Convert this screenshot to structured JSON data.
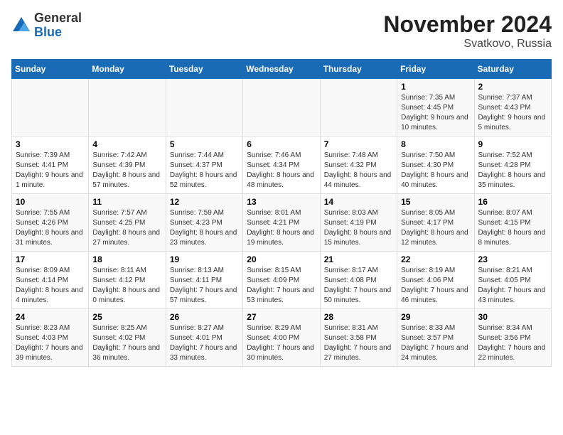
{
  "header": {
    "logo_general": "General",
    "logo_blue": "Blue",
    "month_title": "November 2024",
    "location": "Svatkovo, Russia"
  },
  "weekdays": [
    "Sunday",
    "Monday",
    "Tuesday",
    "Wednesday",
    "Thursday",
    "Friday",
    "Saturday"
  ],
  "weeks": [
    [
      null,
      null,
      null,
      null,
      null,
      {
        "day": "1",
        "sunrise": "Sunrise: 7:35 AM",
        "sunset": "Sunset: 4:45 PM",
        "daylight": "Daylight: 9 hours and 10 minutes."
      },
      {
        "day": "2",
        "sunrise": "Sunrise: 7:37 AM",
        "sunset": "Sunset: 4:43 PM",
        "daylight": "Daylight: 9 hours and 5 minutes."
      }
    ],
    [
      {
        "day": "3",
        "sunrise": "Sunrise: 7:39 AM",
        "sunset": "Sunset: 4:41 PM",
        "daylight": "Daylight: 9 hours and 1 minute."
      },
      {
        "day": "4",
        "sunrise": "Sunrise: 7:42 AM",
        "sunset": "Sunset: 4:39 PM",
        "daylight": "Daylight: 8 hours and 57 minutes."
      },
      {
        "day": "5",
        "sunrise": "Sunrise: 7:44 AM",
        "sunset": "Sunset: 4:37 PM",
        "daylight": "Daylight: 8 hours and 52 minutes."
      },
      {
        "day": "6",
        "sunrise": "Sunrise: 7:46 AM",
        "sunset": "Sunset: 4:34 PM",
        "daylight": "Daylight: 8 hours and 48 minutes."
      },
      {
        "day": "7",
        "sunrise": "Sunrise: 7:48 AM",
        "sunset": "Sunset: 4:32 PM",
        "daylight": "Daylight: 8 hours and 44 minutes."
      },
      {
        "day": "8",
        "sunrise": "Sunrise: 7:50 AM",
        "sunset": "Sunset: 4:30 PM",
        "daylight": "Daylight: 8 hours and 40 minutes."
      },
      {
        "day": "9",
        "sunrise": "Sunrise: 7:52 AM",
        "sunset": "Sunset: 4:28 PM",
        "daylight": "Daylight: 8 hours and 35 minutes."
      }
    ],
    [
      {
        "day": "10",
        "sunrise": "Sunrise: 7:55 AM",
        "sunset": "Sunset: 4:26 PM",
        "daylight": "Daylight: 8 hours and 31 minutes."
      },
      {
        "day": "11",
        "sunrise": "Sunrise: 7:57 AM",
        "sunset": "Sunset: 4:25 PM",
        "daylight": "Daylight: 8 hours and 27 minutes."
      },
      {
        "day": "12",
        "sunrise": "Sunrise: 7:59 AM",
        "sunset": "Sunset: 4:23 PM",
        "daylight": "Daylight: 8 hours and 23 minutes."
      },
      {
        "day": "13",
        "sunrise": "Sunrise: 8:01 AM",
        "sunset": "Sunset: 4:21 PM",
        "daylight": "Daylight: 8 hours and 19 minutes."
      },
      {
        "day": "14",
        "sunrise": "Sunrise: 8:03 AM",
        "sunset": "Sunset: 4:19 PM",
        "daylight": "Daylight: 8 hours and 15 minutes."
      },
      {
        "day": "15",
        "sunrise": "Sunrise: 8:05 AM",
        "sunset": "Sunset: 4:17 PM",
        "daylight": "Daylight: 8 hours and 12 minutes."
      },
      {
        "day": "16",
        "sunrise": "Sunrise: 8:07 AM",
        "sunset": "Sunset: 4:15 PM",
        "daylight": "Daylight: 8 hours and 8 minutes."
      }
    ],
    [
      {
        "day": "17",
        "sunrise": "Sunrise: 8:09 AM",
        "sunset": "Sunset: 4:14 PM",
        "daylight": "Daylight: 8 hours and 4 minutes."
      },
      {
        "day": "18",
        "sunrise": "Sunrise: 8:11 AM",
        "sunset": "Sunset: 4:12 PM",
        "daylight": "Daylight: 8 hours and 0 minutes."
      },
      {
        "day": "19",
        "sunrise": "Sunrise: 8:13 AM",
        "sunset": "Sunset: 4:11 PM",
        "daylight": "Daylight: 7 hours and 57 minutes."
      },
      {
        "day": "20",
        "sunrise": "Sunrise: 8:15 AM",
        "sunset": "Sunset: 4:09 PM",
        "daylight": "Daylight: 7 hours and 53 minutes."
      },
      {
        "day": "21",
        "sunrise": "Sunrise: 8:17 AM",
        "sunset": "Sunset: 4:08 PM",
        "daylight": "Daylight: 7 hours and 50 minutes."
      },
      {
        "day": "22",
        "sunrise": "Sunrise: 8:19 AM",
        "sunset": "Sunset: 4:06 PM",
        "daylight": "Daylight: 7 hours and 46 minutes."
      },
      {
        "day": "23",
        "sunrise": "Sunrise: 8:21 AM",
        "sunset": "Sunset: 4:05 PM",
        "daylight": "Daylight: 7 hours and 43 minutes."
      }
    ],
    [
      {
        "day": "24",
        "sunrise": "Sunrise: 8:23 AM",
        "sunset": "Sunset: 4:03 PM",
        "daylight": "Daylight: 7 hours and 39 minutes."
      },
      {
        "day": "25",
        "sunrise": "Sunrise: 8:25 AM",
        "sunset": "Sunset: 4:02 PM",
        "daylight": "Daylight: 7 hours and 36 minutes."
      },
      {
        "day": "26",
        "sunrise": "Sunrise: 8:27 AM",
        "sunset": "Sunset: 4:01 PM",
        "daylight": "Daylight: 7 hours and 33 minutes."
      },
      {
        "day": "27",
        "sunrise": "Sunrise: 8:29 AM",
        "sunset": "Sunset: 4:00 PM",
        "daylight": "Daylight: 7 hours and 30 minutes."
      },
      {
        "day": "28",
        "sunrise": "Sunrise: 8:31 AM",
        "sunset": "Sunset: 3:58 PM",
        "daylight": "Daylight: 7 hours and 27 minutes."
      },
      {
        "day": "29",
        "sunrise": "Sunrise: 8:33 AM",
        "sunset": "Sunset: 3:57 PM",
        "daylight": "Daylight: 7 hours and 24 minutes."
      },
      {
        "day": "30",
        "sunrise": "Sunrise: 8:34 AM",
        "sunset": "Sunset: 3:56 PM",
        "daylight": "Daylight: 7 hours and 22 minutes."
      }
    ]
  ]
}
